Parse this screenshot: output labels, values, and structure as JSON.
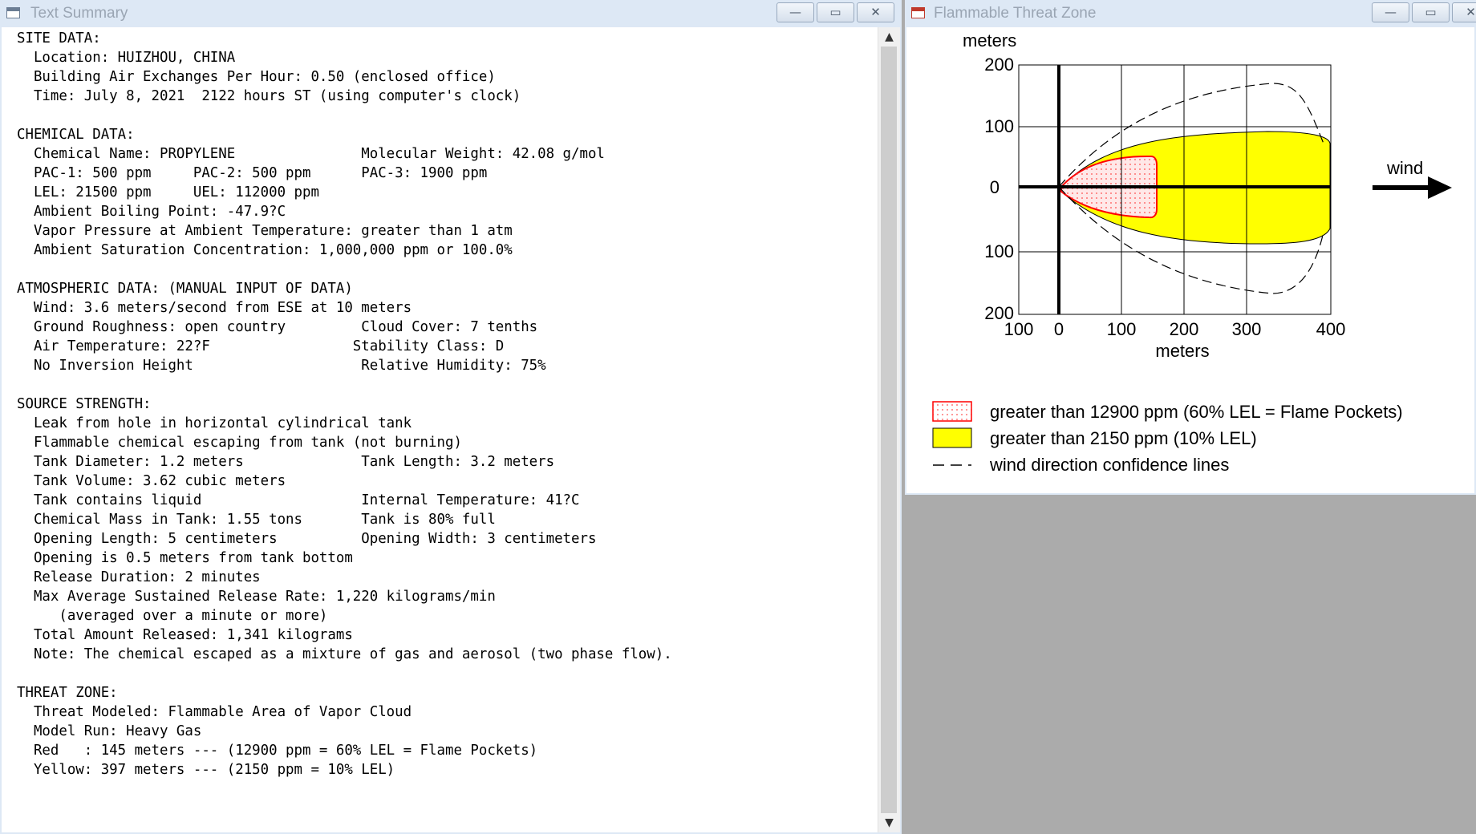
{
  "summary": {
    "title": "Text Summary",
    "controls": {
      "minimize": "—",
      "maximize": "▭",
      "close": "✕"
    },
    "scroll_up": "▲",
    "scroll_down": "▼",
    "lines": [
      "SITE DATA:",
      "  Location: HUIZHOU, CHINA",
      "  Building Air Exchanges Per Hour: 0.50 (enclosed office)",
      "  Time: July 8, 2021  2122 hours ST (using computer's clock)",
      "",
      "CHEMICAL DATA:",
      "  Chemical Name: PROPYLENE               Molecular Weight: 42.08 g/mol",
      "  PAC-1: 500 ppm     PAC-2: 500 ppm      PAC-3: 1900 ppm",
      "  LEL: 21500 ppm     UEL: 112000 ppm",
      "  Ambient Boiling Point: -47.9?C",
      "  Vapor Pressure at Ambient Temperature: greater than 1 atm",
      "  Ambient Saturation Concentration: 1,000,000 ppm or 100.0%",
      "",
      "ATMOSPHERIC DATA: (MANUAL INPUT OF DATA)",
      "  Wind: 3.6 meters/second from ESE at 10 meters",
      "  Ground Roughness: open country         Cloud Cover: 7 tenths",
      "  Air Temperature: 22?F                 Stability Class: D",
      "  No Inversion Height                    Relative Humidity: 75%",
      "",
      "SOURCE STRENGTH:",
      "  Leak from hole in horizontal cylindrical tank",
      "  Flammable chemical escaping from tank (not burning)",
      "  Tank Diameter: 1.2 meters              Tank Length: 3.2 meters",
      "  Tank Volume: 3.62 cubic meters",
      "  Tank contains liquid                   Internal Temperature: 41?C",
      "  Chemical Mass in Tank: 1.55 tons       Tank is 80% full",
      "  Opening Length: 5 centimeters          Opening Width: 3 centimeters",
      "  Opening is 0.5 meters from tank bottom",
      "  Release Duration: 2 minutes",
      "  Max Average Sustained Release Rate: 1,220 kilograms/min",
      "     (averaged over a minute or more)",
      "  Total Amount Released: 1,341 kilograms",
      "  Note: The chemical escaped as a mixture of gas and aerosol (two phase flow).",
      "",
      "THREAT ZONE:",
      "  Threat Modeled: Flammable Area of Vapor Cloud",
      "  Model Run: Heavy Gas",
      "  Red   : 145 meters --- (12900 ppm = 60% LEL = Flame Pockets)",
      "  Yellow: 397 meters --- (2150 ppm = 10% LEL)"
    ]
  },
  "threat": {
    "title": "Flammable Threat Zone",
    "controls": {
      "minimize": "—",
      "maximize": "▭",
      "close": "✕"
    },
    "y_unit": "meters",
    "x_unit": "meters",
    "y_ticks": [
      "200",
      "100",
      "0",
      "100",
      "200"
    ],
    "x_ticks": [
      "100",
      "0",
      "100",
      "200",
      "300",
      "400"
    ],
    "wind_label": "wind",
    "legend": [
      {
        "label": "greater than 12900 ppm (60% LEL = Flame Pockets)",
        "color": "#ff0000"
      },
      {
        "label": "greater than 2150 ppm (10% LEL)",
        "color": "#ffff00"
      },
      {
        "label": "wind direction confidence lines",
        "color": "#000000"
      }
    ]
  },
  "colors": {
    "desktop": "#ababab",
    "titlebar": "#dde8f5",
    "yellow_zone": "#ffff00",
    "red_zone": "#ff0000"
  }
}
